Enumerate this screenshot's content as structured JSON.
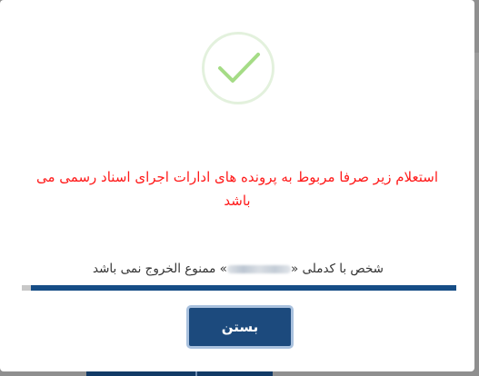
{
  "modal": {
    "icon": "check-icon",
    "message": "استعلام زیر صرفا مربوط به پرونده های ادارات اجرای اسناد رسمی می باشد",
    "status_prefix": "شخص با کدملی «",
    "status_suffix": "» ممنوع الخروج نمی باشد",
    "progress": 0.98,
    "close_label": "بستن"
  },
  "colors": {
    "message": "#ff1a1a",
    "check": "#a5dc86",
    "check_ring": "#e3f1dd",
    "button": "#1c4a7d",
    "progress": "#164d86"
  }
}
